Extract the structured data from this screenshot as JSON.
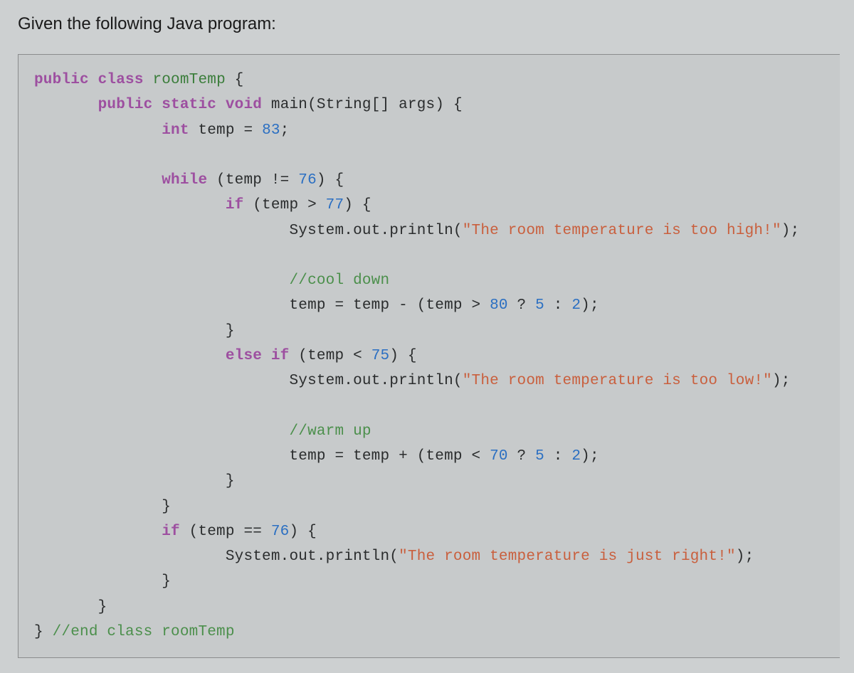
{
  "prompt": "Given the following Java program:",
  "code": {
    "kw_public1": "public",
    "kw_class": "class",
    "className": "roomTemp",
    "brace_open1": " {",
    "indent1": "       ",
    "kw_public2": "public",
    "kw_static": "static",
    "kw_void": "void",
    "mainSig": "main(String[] args)",
    "brace_open2": " {",
    "indent2": "              ",
    "kw_int": "int",
    "tempEq": " temp = ",
    "num83": "83",
    "semi": ";",
    "kw_while": "while",
    "whileCond": " (temp != ",
    "num76a": "76",
    "closeParenBrace": ") {",
    "indent3": "                     ",
    "kw_if1": "if",
    "ifCond1a": " (temp > ",
    "num77": "77",
    "closeParenBrace2": ") {",
    "indent4": "                            ",
    "print1a": "System.out.println(",
    "str1": "\"The room temperature is too high!\"",
    "print1b": ");",
    "comment1": "//cool down",
    "line_cool": "temp = temp - (temp > ",
    "num80": "80",
    "ternary1": " ? ",
    "num5a": "5",
    "colon1": " : ",
    "num2a": "2",
    "endTern1": ");",
    "closeBrace1": "}",
    "kw_else": "else",
    "kw_if2": "if",
    "ifCond2a": " (temp < ",
    "num75": "75",
    "closeParenBrace3": ") {",
    "print2a": "System.out.println(",
    "str2": "\"The room temperature is too low!\"",
    "print2b": ");",
    "comment2": "//warm up",
    "line_warm": "temp = temp + (temp < ",
    "num70": "70",
    "ternary2": " ? ",
    "num5b": "5",
    "colon2": " : ",
    "num2b": "2",
    "endTern2": ");",
    "closeBrace2": "}",
    "closeBrace3": "}",
    "kw_if3": "if",
    "ifCond3": " (temp == ",
    "num76b": "76",
    "closeParenBrace4": ") {",
    "print3a": "System.out.println(",
    "str3": "\"The room temperature is just right!\"",
    "print3b": ");",
    "closeBrace4": "}",
    "closeBrace5": "}",
    "closeBrace6": "} ",
    "endComment": "//end class roomTemp"
  }
}
